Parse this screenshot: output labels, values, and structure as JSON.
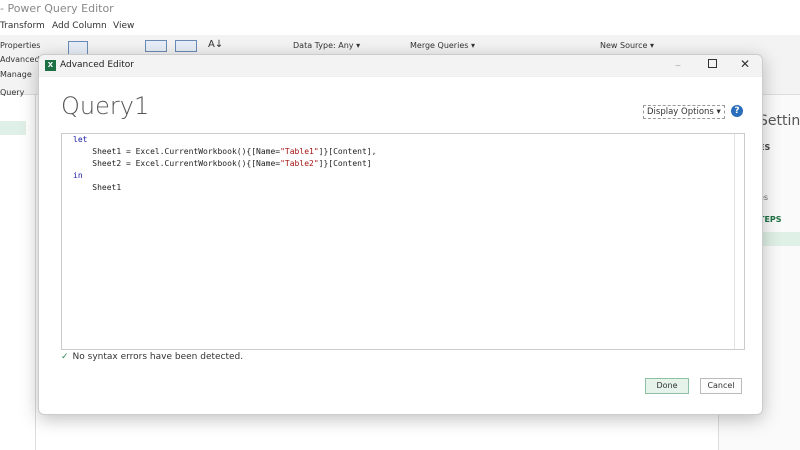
{
  "app": {
    "title": "- Power Query Editor"
  },
  "tabs": [
    "Transform",
    "Add Column",
    "View"
  ],
  "ribbon": {
    "left_items": [
      "Properties",
      "Advanced Ed",
      "Manage"
    ],
    "group_label": "Query",
    "data_type": "Data Type: Any",
    "merge": "Merge Queries",
    "new_source": "New Source"
  },
  "right_panel": {
    "title": "Settings",
    "section1": "ES",
    "item": "es",
    "section2": "TEPS"
  },
  "dialog": {
    "title": "Advanced Editor",
    "query_name": "Query1",
    "display_options": "Display Options",
    "code_lines": [
      "let",
      "    Sheet1 = Excel.CurrentWorkbook(){[Name=\"Table1\"]}[Content],",
      "    Sheet2 = Excel.CurrentWorkbook(){[Name=\"Table2\"]}[Content]",
      "in",
      "    Sheet1"
    ],
    "status": "No syntax errors have been detected.",
    "done": "Done",
    "cancel": "Cancel"
  },
  "colors": {
    "accent": "#1d7044",
    "selected": "#dff0e6",
    "help": "#2a6ebb"
  }
}
